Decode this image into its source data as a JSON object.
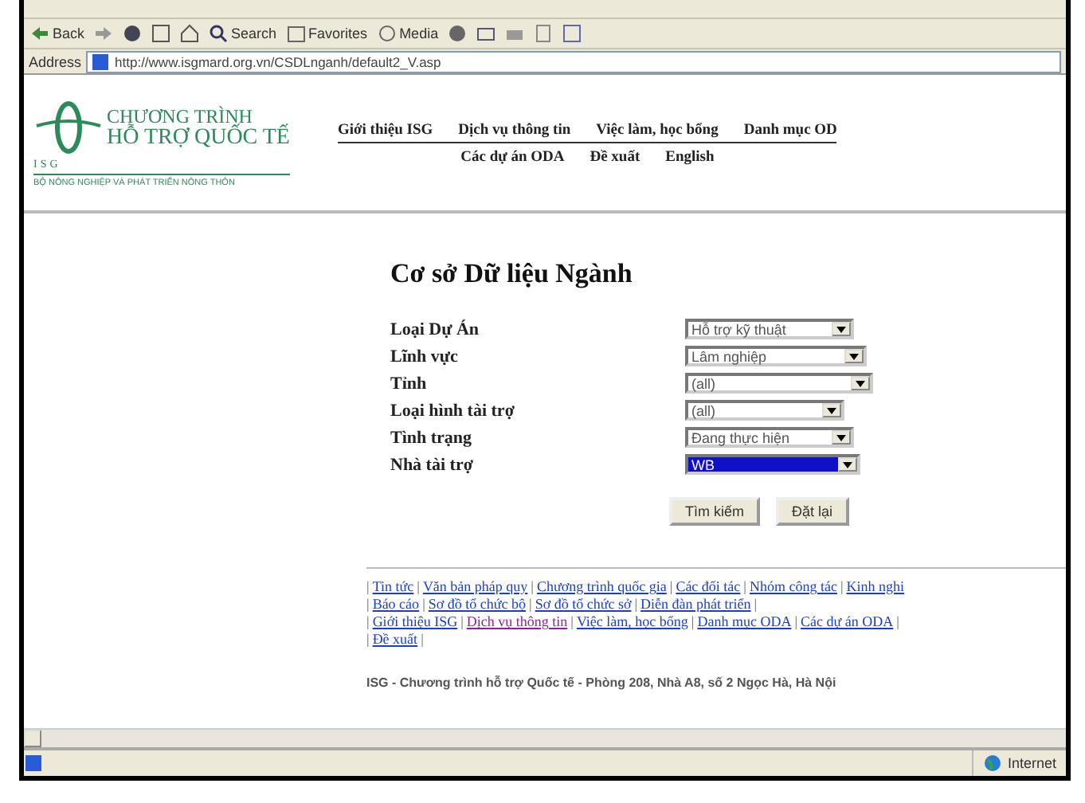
{
  "toolbar": {
    "back": "Back",
    "search": "Search",
    "favorites": "Favorites",
    "media": "Media"
  },
  "address_bar": {
    "label": "Address",
    "url": "http://www.isgmard.org.vn/CSDLnganh/default2_V.asp"
  },
  "logo": {
    "line1": "CHƯƠNG TRÌNH",
    "line2": "HỖ TRỢ QUỐC TẾ",
    "mark": "ISG",
    "ministry": "BỘ NÔNG NGHIỆP VÀ PHÁT TRIỂN NÔNG THÔN"
  },
  "top_nav": [
    [
      "Giới thiệu ISG",
      "Dịch vụ thông tin",
      "Việc làm, học bổng",
      "Danh mục OD"
    ],
    [
      "Các dự án ODA",
      "Đề xuất",
      "English"
    ]
  ],
  "title": "Cơ sở Dữ liệu Ngành",
  "fields": [
    {
      "label": "Loại Dự Án",
      "value": "Hỗ trợ kỹ thuật",
      "selected": false
    },
    {
      "label": "Lĩnh vực",
      "value": "Lâm nghiệp",
      "selected": false
    },
    {
      "label": "Tỉnh",
      "value": "(all)",
      "selected": false
    },
    {
      "label": "Loại hình tài trợ",
      "value": "(all)",
      "selected": false
    },
    {
      "label": "Tình trạng",
      "value": "Đang thực hiện",
      "selected": false
    },
    {
      "label": "Nhà tài trợ",
      "value": "WB",
      "selected": true
    }
  ],
  "buttons": [
    "Tìm kiếm",
    "Đặt lại"
  ],
  "separator": "|",
  "footer_links": [
    [
      {
        "label": "Tin tức",
        "visited": false
      },
      {
        "label": "Văn bản pháp quy",
        "visited": false
      },
      {
        "label": "Chương trình quốc gia",
        "visited": false
      },
      {
        "label": "Các đối tác",
        "visited": false
      },
      {
        "label": "Nhóm công tác",
        "visited": false
      },
      {
        "label": "Kinh nghi",
        "visited": false
      }
    ],
    [
      {
        "label": "Báo cáo",
        "visited": false
      },
      {
        "label": "Sơ đồ tổ chức bộ",
        "visited": false
      },
      {
        "label": "Sơ đồ tổ chức sở",
        "visited": false
      },
      {
        "label": "Diễn đàn phát triển",
        "visited": false
      }
    ],
    [
      {
        "label": "Giới thiệu ISG",
        "visited": false
      },
      {
        "label": "Dịch vụ thông tin",
        "visited": true
      },
      {
        "label": "Việc làm, học bổng",
        "visited": false
      },
      {
        "label": "Danh mục ODA",
        "visited": false
      },
      {
        "label": "Các dự án ODA",
        "visited": false
      }
    ],
    [
      {
        "label": "Đề xuất",
        "visited": false
      }
    ]
  ],
  "footer_text": "ISG - Chương trình hỗ trợ Quốc tế - Phòng 208, Nhà A8, số 2 Ngọc Hà, Hà Nội",
  "status_bar": {
    "zone": "Internet"
  }
}
